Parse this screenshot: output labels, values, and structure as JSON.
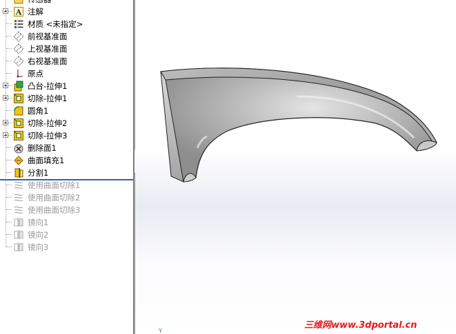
{
  "feature_tree": {
    "items": [
      {
        "label": "传感器",
        "icon": "sensor-icon",
        "expandable": false,
        "suppressed": false
      },
      {
        "label": "注解",
        "icon": "annotations-icon",
        "expandable": true,
        "suppressed": false
      },
      {
        "label": "材质 <未指定>",
        "icon": "material-icon",
        "expandable": false,
        "suppressed": false
      },
      {
        "label": "前视基准面",
        "icon": "plane-icon",
        "expandable": false,
        "suppressed": false
      },
      {
        "label": "上视基准面",
        "icon": "plane-icon",
        "expandable": false,
        "suppressed": false
      },
      {
        "label": "右视基准面",
        "icon": "plane-icon",
        "expandable": false,
        "suppressed": false
      },
      {
        "label": "原点",
        "icon": "origin-icon",
        "expandable": false,
        "suppressed": false
      },
      {
        "label": "凸台-拉伸1",
        "icon": "boss-extrude-icon",
        "expandable": true,
        "suppressed": false
      },
      {
        "label": "切除-拉伸1",
        "icon": "cut-extrude-icon",
        "expandable": true,
        "suppressed": false
      },
      {
        "label": "圆角1",
        "icon": "fillet-icon",
        "expandable": false,
        "suppressed": false
      },
      {
        "label": "切除-拉伸2",
        "icon": "cut-extrude-icon",
        "expandable": true,
        "suppressed": false
      },
      {
        "label": "切除-拉伸3",
        "icon": "cut-extrude-icon",
        "expandable": true,
        "suppressed": false
      },
      {
        "label": "删除面1",
        "icon": "delete-face-icon",
        "expandable": false,
        "suppressed": false
      },
      {
        "label": "曲面填充1",
        "icon": "fill-surface-icon",
        "expandable": false,
        "suppressed": false
      },
      {
        "label": "分割1",
        "icon": "split-icon",
        "expandable": false,
        "suppressed": false
      },
      {
        "label": "使用曲面切除1",
        "icon": "surface-cut-icon",
        "expandable": false,
        "suppressed": true
      },
      {
        "label": "使用曲面切除2",
        "icon": "surface-cut-icon",
        "expandable": false,
        "suppressed": true
      },
      {
        "label": "使用曲面切除3",
        "icon": "surface-cut-icon",
        "expandable": false,
        "suppressed": true
      },
      {
        "label": "镜向1",
        "icon": "mirror-icon",
        "expandable": false,
        "suppressed": true
      },
      {
        "label": "镜向2",
        "icon": "mirror-icon",
        "expandable": false,
        "suppressed": true
      },
      {
        "label": "镜向3",
        "icon": "mirror-icon",
        "expandable": false,
        "suppressed": true
      }
    ]
  },
  "viewport": {
    "axis_label": "Y",
    "watermark": "三维网www.3dportal.cn",
    "model_color": "#a9a9a9"
  },
  "colors": {
    "rollback_bar": "#2b5fb7",
    "suppressed_text": "#9a9a9a",
    "watermark": "#e8191b"
  }
}
